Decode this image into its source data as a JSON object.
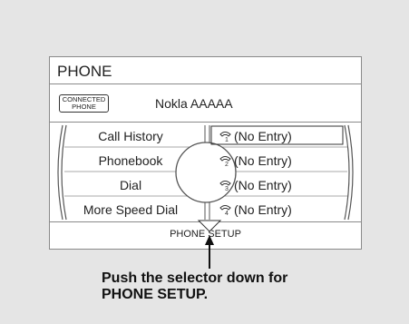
{
  "screen": {
    "title": "PHONE",
    "connection": {
      "badge_line1": "CONNECTED",
      "badge_line2": "PHONE",
      "device_name": "Nokla AAAAA"
    },
    "menu_items": [
      {
        "label": "Call History"
      },
      {
        "label": "Phonebook"
      },
      {
        "label": "Dial"
      },
      {
        "label": "More Speed Dial"
      }
    ],
    "speed_dial": [
      {
        "slot": "1",
        "label": "(No Entry)",
        "icon": "phone-1-icon",
        "selected": true
      },
      {
        "slot": "2",
        "label": "(No Entry)",
        "icon": "phone-2-icon"
      },
      {
        "slot": "3",
        "label": "(No Entry)",
        "icon": "phone-3-icon"
      },
      {
        "slot": "4",
        "label": "(No Entry)",
        "icon": "phone-4-icon"
      }
    ],
    "footer_label": "PHONE SETUP"
  },
  "callout": {
    "line1": "Push the selector down for",
    "line2": "PHONE SETUP."
  },
  "colors": {
    "background": "#e5e5e5",
    "panel": "#ffffff",
    "border": "#8a8a8a",
    "text": "#222222"
  }
}
